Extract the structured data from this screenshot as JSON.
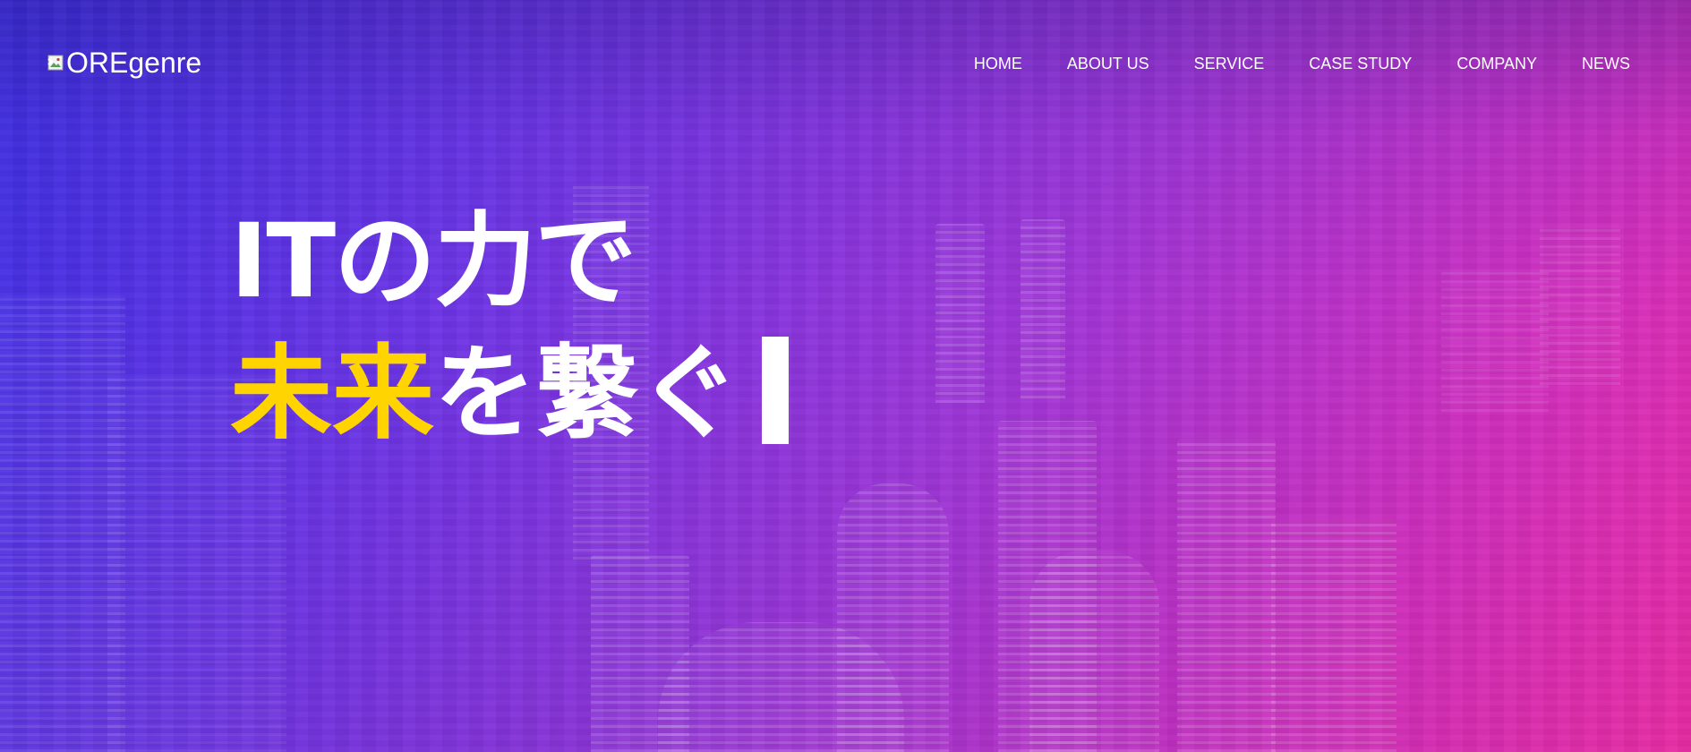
{
  "header": {
    "logo_alt": "OREgenre",
    "nav": [
      {
        "label": "HOME"
      },
      {
        "label": "ABOUT US"
      },
      {
        "label": "SERVICE"
      },
      {
        "label": "CASE STUDY"
      },
      {
        "label": "COMPANY"
      },
      {
        "label": "NEWS"
      }
    ]
  },
  "hero": {
    "line1": "ITの力で",
    "line2_highlight": "未来",
    "line2_rest": "を繋ぐ"
  },
  "colors": {
    "highlight": "#ffd400",
    "text": "#ffffff",
    "gradient_start": "#3a2fe3",
    "gradient_end": "#ef2ea8"
  },
  "icons": {
    "logo_placeholder": "broken-image-icon"
  }
}
